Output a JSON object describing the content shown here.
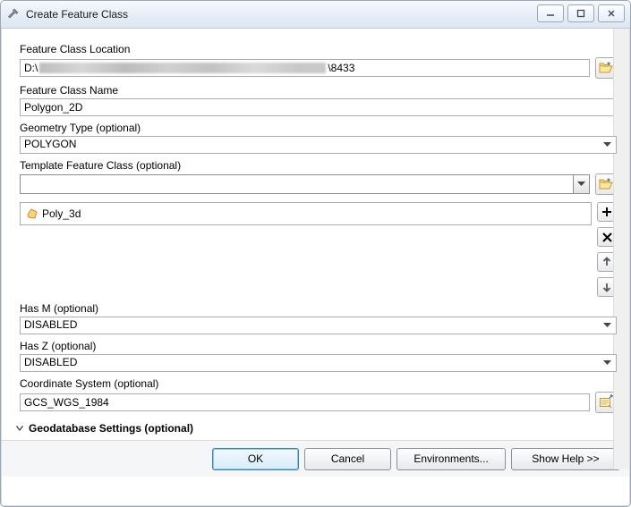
{
  "window": {
    "title": "Create Feature Class"
  },
  "fields": {
    "location": {
      "label": "Feature Class Location",
      "path_prefix": "D:\\",
      "path_suffix": "\\8433"
    },
    "name": {
      "label": "Feature Class Name",
      "value": "Polygon_2D"
    },
    "geom": {
      "label": "Geometry Type (optional)",
      "value": "POLYGON"
    },
    "template": {
      "label": "Template Feature Class (optional)",
      "items": [
        "Poly_3d"
      ]
    },
    "hasm": {
      "label": "Has M (optional)",
      "value": "DISABLED"
    },
    "hasz": {
      "label": "Has Z (optional)",
      "value": "DISABLED"
    },
    "crs": {
      "label": "Coordinate System (optional)",
      "value": "GCS_WGS_1984"
    }
  },
  "expander": {
    "label": "Geodatabase Settings (optional)"
  },
  "buttons": {
    "ok": "OK",
    "cancel": "Cancel",
    "env": "Environments...",
    "help": "Show Help >>"
  },
  "icons": {
    "browse": "open-folder-icon",
    "add": "plus-icon",
    "remove": "x-icon",
    "up": "arrow-up-icon",
    "down": "arrow-down-icon",
    "crs_browse": "crs-browse-icon",
    "fc_item": "polygon-fc-icon",
    "tool": "hammer-icon"
  }
}
